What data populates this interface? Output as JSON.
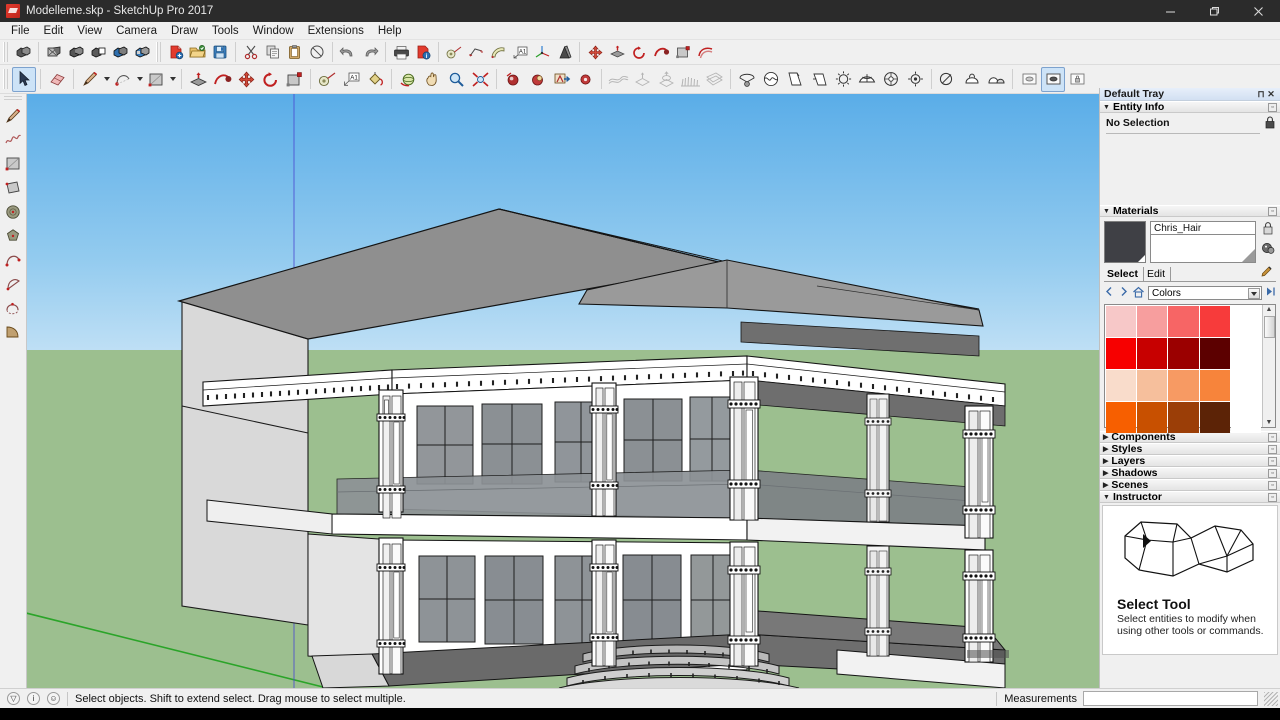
{
  "window": {
    "title": "Modelleme.skp - SketchUp Pro 2017",
    "app_icon": "sketchup-logo-icon",
    "controls": {
      "minimize": "minimize-icon",
      "restore": "restore-icon",
      "close": "close-icon"
    }
  },
  "menu": {
    "items": [
      "File",
      "Edit",
      "View",
      "Camera",
      "Draw",
      "Tools",
      "Window",
      "Extensions",
      "Help"
    ]
  },
  "toolbar_row1": {
    "groups": [
      {
        "name": "view-styles",
        "buttons": [
          {
            "name": "iso-view-button",
            "icon": "iso-view-icon"
          },
          {
            "name": "xray-view-button",
            "icon": "xray-icon"
          },
          {
            "name": "wireframe-view-button",
            "icon": "wireframe-icon"
          },
          {
            "name": "hidden-line-view-button",
            "icon": "hidden-line-icon"
          },
          {
            "name": "shaded-view-button",
            "icon": "shaded-icon"
          },
          {
            "name": "shaded-texture-view-button",
            "icon": "shaded-texture-icon"
          }
        ]
      },
      {
        "name": "file-ops",
        "buttons": [
          {
            "name": "new-button",
            "icon": "new-document-icon"
          },
          {
            "name": "open-button",
            "icon": "open-folder-icon"
          },
          {
            "name": "save-button",
            "icon": "floppy-save-icon"
          }
        ]
      },
      {
        "name": "edit-ops",
        "buttons": [
          {
            "name": "cut-button",
            "icon": "scissors-icon"
          },
          {
            "name": "copy-button",
            "icon": "copy-icon"
          },
          {
            "name": "paste-button",
            "icon": "clipboard-paste-icon"
          },
          {
            "name": "erase-button",
            "icon": "erase-circle-icon"
          }
        ]
      },
      {
        "name": "undo-redo",
        "buttons": [
          {
            "name": "undo-button",
            "icon": "undo-arrow-icon"
          },
          {
            "name": "redo-button",
            "icon": "redo-arrow-icon"
          }
        ]
      },
      {
        "name": "print-model",
        "buttons": [
          {
            "name": "print-button",
            "icon": "printer-icon"
          },
          {
            "name": "model-info-button",
            "icon": "model-info-icon"
          }
        ]
      },
      {
        "name": "construction",
        "buttons": [
          {
            "name": "tape-measure-button",
            "icon": "tape-measure-icon"
          },
          {
            "name": "dimension-button",
            "icon": "dimension-icon"
          },
          {
            "name": "protractor-button",
            "icon": "protractor-icon"
          },
          {
            "name": "text-button",
            "icon": "text-label-icon"
          },
          {
            "name": "axes-button",
            "icon": "axes-icon"
          },
          {
            "name": "3d-text-button",
            "icon": "3d-text-icon"
          }
        ]
      },
      {
        "name": "modify",
        "buttons": [
          {
            "name": "move-button",
            "icon": "move-arrows-icon"
          },
          {
            "name": "pushpull-button",
            "icon": "push-pull-icon"
          },
          {
            "name": "rotate-button",
            "icon": "rotate-icon"
          },
          {
            "name": "followme-button",
            "icon": "follow-me-icon"
          },
          {
            "name": "scale-button",
            "icon": "scale-icon"
          },
          {
            "name": "offset-button",
            "icon": "offset-icon"
          }
        ]
      }
    ]
  },
  "toolbar_row2": {
    "groups": [
      {
        "name": "principal",
        "buttons": [
          {
            "name": "select-tool-button",
            "icon": "select-arrow-icon",
            "active": true
          },
          {
            "name": "eraser-tool-button",
            "icon": "eraser-icon"
          }
        ]
      },
      {
        "name": "drawing",
        "buttons": [
          {
            "name": "line-tool-button",
            "icon": "pencil-line-icon",
            "has_menu": true
          },
          {
            "name": "arc-tool-button",
            "icon": "arc-icon",
            "has_menu": true
          },
          {
            "name": "rectangle-tool-button",
            "icon": "rectangle-icon",
            "has_menu": true
          }
        ]
      },
      {
        "name": "editing",
        "buttons": [
          {
            "name": "pushpull-tool-button",
            "icon": "push-pull-icon"
          },
          {
            "name": "followme-tool-button",
            "icon": "follow-me-icon"
          },
          {
            "name": "move-tool-button",
            "icon": "move-arrows-icon"
          },
          {
            "name": "rotate-tool-button",
            "icon": "rotate-icon"
          },
          {
            "name": "scale-tool-button",
            "icon": "scale-icon"
          }
        ]
      },
      {
        "name": "construction2",
        "buttons": [
          {
            "name": "tape-measure-tool-button",
            "icon": "tape-measure-icon"
          },
          {
            "name": "text-tool-button",
            "icon": "text-label-icon"
          },
          {
            "name": "paint-bucket-tool-button",
            "icon": "paint-bucket-icon"
          }
        ]
      },
      {
        "name": "camera",
        "buttons": [
          {
            "name": "orbit-tool-button",
            "icon": "orbit-icon"
          },
          {
            "name": "pan-tool-button",
            "icon": "pan-hand-icon"
          },
          {
            "name": "zoom-tool-button",
            "icon": "magnifier-icon"
          },
          {
            "name": "zoom-extents-button",
            "icon": "zoom-extents-icon"
          }
        ]
      },
      {
        "name": "walkthrough",
        "buttons": [
          {
            "name": "position-camera-button",
            "icon": "position-camera-icon"
          },
          {
            "name": "look-around-button",
            "icon": "look-around-icon"
          },
          {
            "name": "walk-button",
            "icon": "walk-icon"
          },
          {
            "name": "section-plane-button",
            "icon": "section-plane-icon"
          }
        ]
      },
      {
        "name": "sandbox",
        "buttons": [
          {
            "name": "from-contours-button",
            "icon": "from-contours-icon",
            "disabled": true
          },
          {
            "name": "from-scratch-button",
            "icon": "from-scratch-icon",
            "disabled": true
          },
          {
            "name": "smoove-button",
            "icon": "smoove-icon",
            "disabled": true
          },
          {
            "name": "stamp-button",
            "icon": "stamp-icon",
            "disabled": true
          },
          {
            "name": "drape-button",
            "icon": "drape-icon",
            "disabled": true
          }
        ]
      },
      {
        "name": "location-solar",
        "buttons": [
          {
            "name": "add-location-button",
            "icon": "add-location-icon"
          },
          {
            "name": "toggle-terrain-button",
            "icon": "toggle-terrain-icon"
          },
          {
            "name": "photo-texture-button",
            "icon": "photo-texture-icon"
          },
          {
            "name": "shadow-settings-button",
            "icon": "sun-shadow-icon"
          },
          {
            "name": "north-button",
            "icon": "north-dome-icon"
          },
          {
            "name": "geo-location-button",
            "icon": "globe-icon"
          },
          {
            "name": "solar-north-button",
            "icon": "solar-north-icon"
          }
        ]
      },
      {
        "name": "solid-tools",
        "buttons": [
          {
            "name": "outer-shell-button",
            "icon": "outer-shell-icon"
          },
          {
            "name": "intersect-button",
            "icon": "intersect-icon"
          },
          {
            "name": "union-button",
            "icon": "union-icon"
          }
        ]
      },
      {
        "name": "layers-toolbar",
        "buttons": [
          {
            "name": "layer-visible-button",
            "icon": "layer-visible-icon"
          },
          {
            "name": "layer-active-button",
            "icon": "layer-active-icon"
          },
          {
            "name": "layer-lock-button",
            "icon": "layer-lock-icon"
          }
        ]
      }
    ]
  },
  "left_toolbar": {
    "buttons": [
      {
        "name": "line-tool",
        "icon": "pencil-line-icon"
      },
      {
        "name": "freehand-tool",
        "icon": "freehand-squiggle-icon"
      },
      {
        "name": "rectangle-tool",
        "icon": "rectangle-icon"
      },
      {
        "name": "rotated-rectangle-tool",
        "icon": "rotated-rectangle-icon"
      },
      {
        "name": "circle-tool",
        "icon": "circle-icon"
      },
      {
        "name": "polygon-tool",
        "icon": "polygon-icon"
      },
      {
        "name": "arc-tool",
        "icon": "arc-icon"
      },
      {
        "name": "two-point-arc-tool",
        "icon": "two-point-arc-icon"
      },
      {
        "name": "three-point-arc-tool",
        "icon": "three-point-arc-icon"
      },
      {
        "name": "pie-tool",
        "icon": "pie-icon"
      }
    ]
  },
  "viewport": {
    "sky_top_color": "#5AADE8",
    "sky_horizon_color": "#D3E9F8",
    "ground_color": "#9CBF8F",
    "model_name": "two-story-classical-villa",
    "axis_blue_color": "#3a3ab0",
    "axis_green_color": "#12a012",
    "wall_color": "#FFFFFF",
    "wall_shade_color": "#D8D8D8",
    "roof_color": "#8A8A8A",
    "roof_light_color": "#A5A5A5",
    "glass_color": "#8E9296",
    "deck_color": "#707070"
  },
  "tray": {
    "title": "Default Tray",
    "panels": [
      {
        "name": "entity-info",
        "label": "Entity Info",
        "expanded": true,
        "content": "No Selection"
      },
      {
        "name": "materials",
        "label": "Materials",
        "expanded": true
      },
      {
        "name": "components",
        "label": "Components",
        "expanded": false
      },
      {
        "name": "styles",
        "label": "Styles",
        "expanded": false
      },
      {
        "name": "layers",
        "label": "Layers",
        "expanded": false
      },
      {
        "name": "shadows",
        "label": "Shadows",
        "expanded": false
      },
      {
        "name": "scenes",
        "label": "Scenes",
        "expanded": false
      },
      {
        "name": "instructor",
        "label": "Instructor",
        "expanded": true
      }
    ],
    "materials": {
      "current_name": "Chris_Hair",
      "current_color": "#3f4045",
      "tabs": [
        "Select",
        "Edit"
      ],
      "selected_tab": "Select",
      "library": "Colors",
      "swatches": [
        [
          "#F7C8C8",
          "#F79E9E",
          "#F76565",
          "#F73B3B"
        ],
        [
          "#F70000",
          "#C70000",
          "#9B0000",
          "#5C0000"
        ],
        [
          "#F9DCCB",
          "#F6BF9C",
          "#F79A63",
          "#F7843B"
        ],
        [
          "#F75F00",
          "#C85000",
          "#9B3E07",
          "#5C2306"
        ]
      ]
    },
    "instructor": {
      "title": "Select Tool",
      "description": "Select entities to modify when using other tools or commands.",
      "illustration": "house-wireframe-icon"
    }
  },
  "statusbar": {
    "help_text": "Select objects. Shift to extend select. Drag mouse to select multiple.",
    "icons": [
      "warning-icon",
      "info-icon",
      "credits-icon"
    ],
    "measurements_label": "Measurements",
    "measurements_value": ""
  }
}
